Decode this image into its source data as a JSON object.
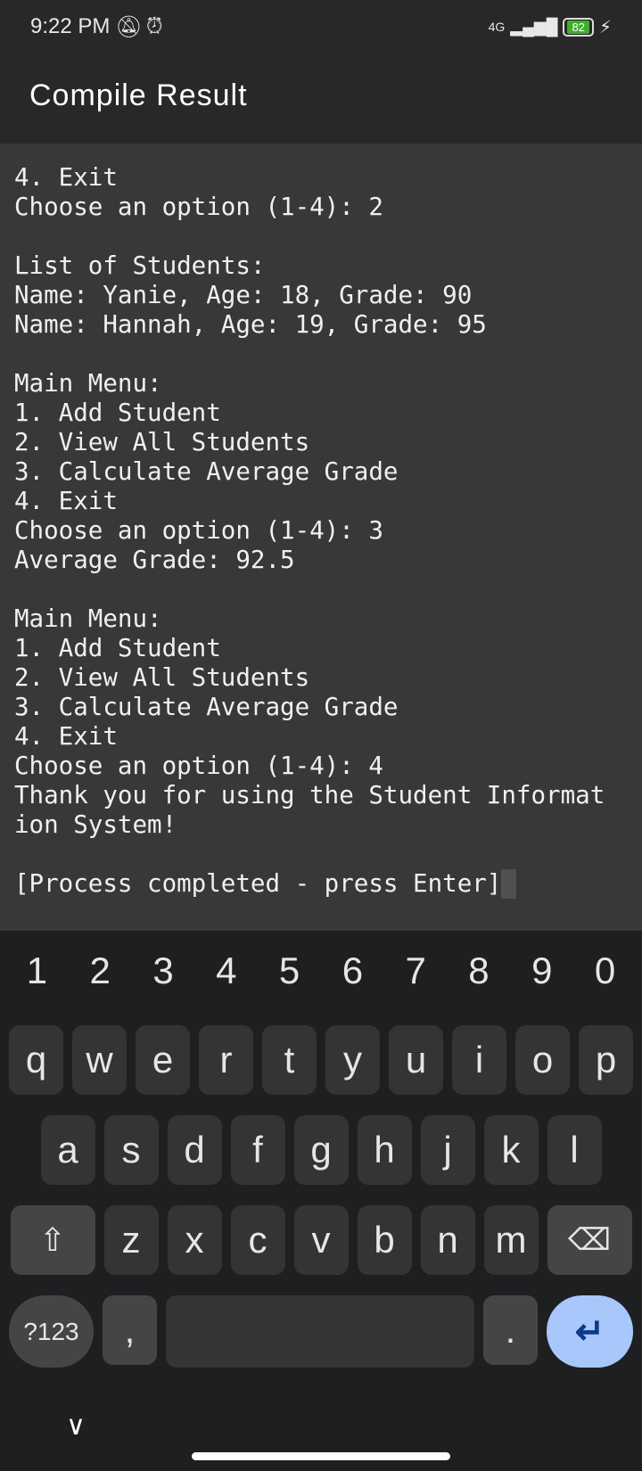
{
  "status": {
    "time": "9:22 PM",
    "network": "4G",
    "battery": "82"
  },
  "appbar": {
    "title": "Compile Result"
  },
  "terminal": {
    "lines": [
      "4. Exit",
      "Choose an option (1-4): 2",
      "",
      "List of Students:",
      "Name: Yanie, Age: 18, Grade: 90",
      "Name: Hannah, Age: 19, Grade: 95",
      "",
      "Main Menu:",
      "1. Add Student",
      "2. View All Students",
      "3. Calculate Average Grade",
      "4. Exit",
      "Choose an option (1-4): 3",
      "Average Grade: 92.5",
      "",
      "Main Menu:",
      "1. Add Student",
      "2. View All Students",
      "3. Calculate Average Grade",
      "4. Exit",
      "Choose an option (1-4): 4",
      "Thank you for using the Student Informat",
      "ion System!",
      "",
      "[Process completed - press Enter]"
    ]
  },
  "keyboard": {
    "numbers": [
      "1",
      "2",
      "3",
      "4",
      "5",
      "6",
      "7",
      "8",
      "9",
      "0"
    ],
    "row1": [
      "q",
      "w",
      "e",
      "r",
      "t",
      "y",
      "u",
      "i",
      "o",
      "p"
    ],
    "row2": [
      "a",
      "s",
      "d",
      "f",
      "g",
      "h",
      "j",
      "k",
      "l"
    ],
    "row3": [
      "z",
      "x",
      "c",
      "v",
      "b",
      "n",
      "m"
    ],
    "symbols": "?123",
    "comma": ",",
    "period": "."
  }
}
